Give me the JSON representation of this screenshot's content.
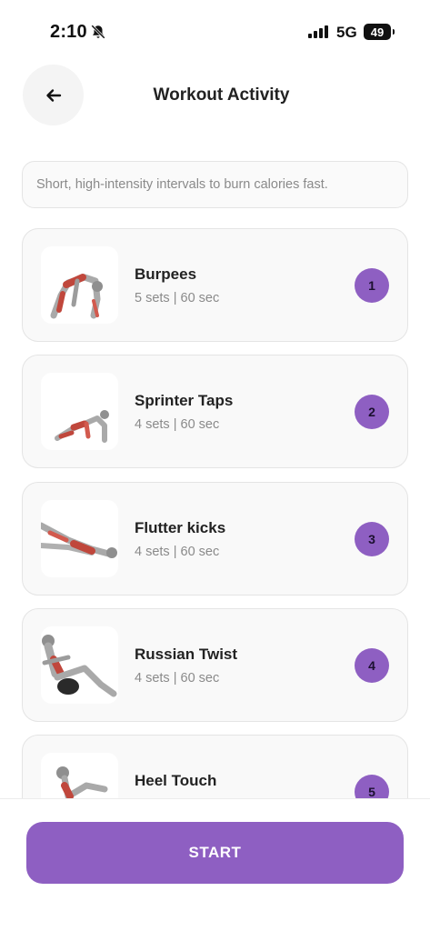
{
  "status_bar": {
    "time": "2:10",
    "network": "5G",
    "battery": "49"
  },
  "header": {
    "title": "Workout Activity"
  },
  "description": "Short, high-intensity intervals to burn calories fast.",
  "exercises": [
    {
      "name": "Burpees",
      "meta": "5 sets | 60 sec",
      "number": "1"
    },
    {
      "name": "Sprinter Taps",
      "meta": "4 sets | 60 sec",
      "number": "2"
    },
    {
      "name": "Flutter kicks",
      "meta": "4 sets | 60 sec",
      "number": "3"
    },
    {
      "name": "Russian Twist",
      "meta": "4 sets | 60 sec",
      "number": "4"
    },
    {
      "name": "Heel Touch",
      "meta": "",
      "number": "5"
    }
  ],
  "start_label": "START",
  "colors": {
    "accent": "#8e5fc2",
    "card_bg": "#f9f9f9",
    "muted_text": "#8a8a8a"
  }
}
